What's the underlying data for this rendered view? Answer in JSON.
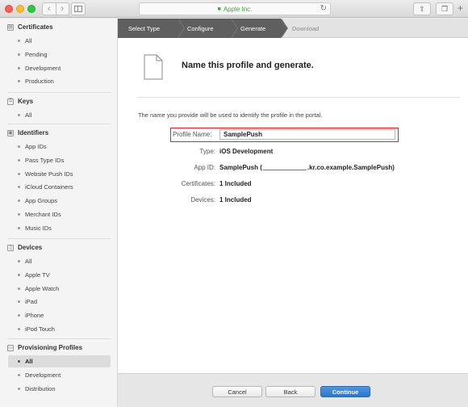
{
  "browser": {
    "site": "Apple Inc.",
    "nav_back": "‹",
    "nav_forward": "›",
    "reload": "↻",
    "plus": "+"
  },
  "sidebar": {
    "sections": [
      {
        "title": "Certificates",
        "icon": "certificate-icon",
        "items": [
          "All",
          "Pending",
          "Development",
          "Production"
        ]
      },
      {
        "title": "Keys",
        "icon": "key-icon",
        "items": [
          "All"
        ]
      },
      {
        "title": "Identifiers",
        "icon": "id-icon",
        "items": [
          "App IDs",
          "Pass Type IDs",
          "Website Push IDs",
          "iCloud Containers",
          "App Groups",
          "Merchant IDs",
          "Music IDs"
        ]
      },
      {
        "title": "Devices",
        "icon": "device-icon",
        "items": [
          "All",
          "Apple TV",
          "Apple Watch",
          "iPad",
          "iPhone",
          "iPod Touch"
        ]
      },
      {
        "title": "Provisioning Profiles",
        "icon": "profile-icon",
        "items": [
          "All",
          "Development",
          "Distribution"
        ],
        "active_index": 0
      }
    ]
  },
  "steps": [
    "Select Type",
    "Configure",
    "Generate",
    "Download"
  ],
  "main": {
    "title": "Name this profile and generate.",
    "description": "The name you provide will be used to identify the profile in the portal.",
    "profile_name_label": "Profile Name:",
    "profile_name_value": "SamplePush",
    "type_label": "Type:",
    "type_value": "iOS Development",
    "appid_label": "App ID:",
    "appid_prefix": "SamplePush (",
    "appid_suffix": ".kr.co.example.SamplePush)",
    "certs_label": "Certificates:",
    "certs_value": "1 Included",
    "devices_label": "Devices:",
    "devices_value": "1 Included"
  },
  "footer": {
    "cancel": "Cancel",
    "back": "Back",
    "continue": "Continue"
  },
  "colors": {
    "accent": "#2d76c9",
    "highlight_border": "#e52525",
    "secure": "#39a93b"
  }
}
